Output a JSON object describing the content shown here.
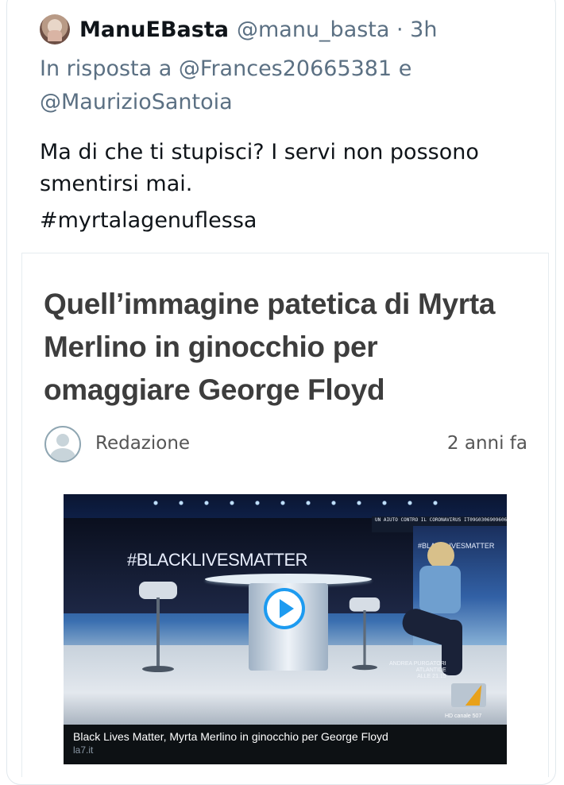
{
  "tweet": {
    "display_name": "ManuEBasta",
    "handle": "@manu_basta · 3h",
    "reply_line_1": "In risposta a @Frances20665381 e",
    "reply_line_2": "@MaurizioSantoia",
    "text": "Ma di che ti stupisci? I servi non possono\nsmentirsi mai.",
    "hashtag": "#myrtalagenuflessa"
  },
  "article": {
    "title": "Quell’immagine patetica di Myrta Merlino in ginocchio per omaggiare George Floyd",
    "author": "Redazione",
    "date": "2 anni fa"
  },
  "video": {
    "screen_text": "#BLACKLIVESMATTER",
    "ticker_text": "UN AIUTO CONTRO IL CORONAVIRUS IT09G030690960610000172051",
    "side_label": "#BLACKLIVESMATTER",
    "lower_third_line1": "ANDREA PURGATORI",
    "lower_third_line2": "ATLANTIDE",
    "lower_third_line3": "ALLE 21.15",
    "channel_label": "HD canale 507",
    "caption_title": "Black Lives Matter, Myrta Merlino in ginocchio per George Floyd",
    "caption_domain": "la7.it"
  },
  "colors": {
    "primary_text": "#0f1419",
    "secondary_text": "#5b7083",
    "accent": "#1d9bf0",
    "article_title": "#3d3d3d"
  },
  "icons": {
    "play": "play-icon",
    "avatar": "user-avatar",
    "author": "author-avatar-placeholder"
  }
}
